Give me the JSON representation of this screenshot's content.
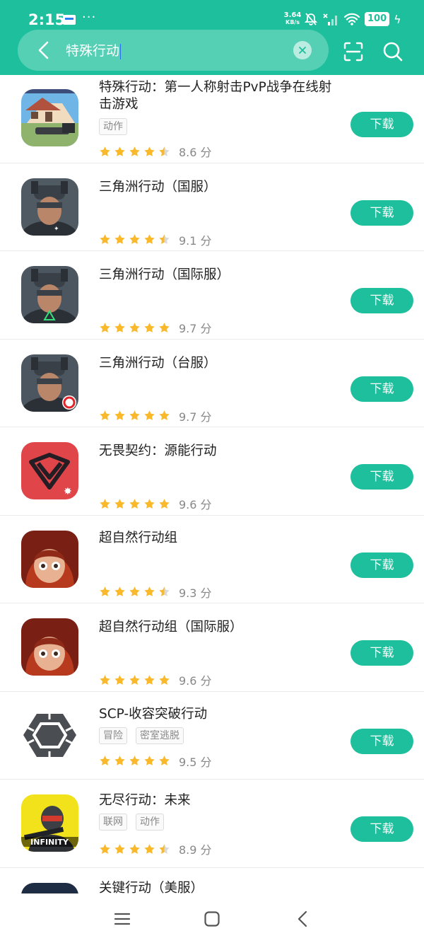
{
  "status_bar": {
    "time": "2:15",
    "dots": "···",
    "net_speed_value": "3.64",
    "net_speed_unit": "KB/s",
    "battery": "100"
  },
  "search": {
    "query": "特殊行动",
    "icons": [
      "back-arrow-icon",
      "clear-icon",
      "scan-icon",
      "search-icon"
    ]
  },
  "download_label": "下载",
  "score_unit": "分",
  "colors": {
    "accent": "#1ebf9c",
    "star": "#f9b92b",
    "star_empty": "#d9d9d9"
  },
  "apps": [
    {
      "title": "特殊行动：第一人称射击PvP战争在线射击游戏",
      "tags": [
        "动作"
      ],
      "rating": 4.5,
      "score": "8.6"
    },
    {
      "title": "三角洲行动（国服）",
      "tags": [],
      "rating": 4.5,
      "score": "9.1"
    },
    {
      "title": "三角洲行动（国际服）",
      "tags": [],
      "rating": 5,
      "score": "9.7"
    },
    {
      "title": "三角洲行动（台服）",
      "tags": [],
      "rating": 5,
      "score": "9.7"
    },
    {
      "title": "无畏契约：源能行动",
      "tags": [],
      "rating": 5,
      "score": "9.6"
    },
    {
      "title": "超自然行动组",
      "tags": [],
      "rating": 4.5,
      "score": "9.3"
    },
    {
      "title": "超自然行动组（国际服）",
      "tags": [],
      "rating": 5,
      "score": "9.6"
    },
    {
      "title": "SCP-收容突破行动",
      "tags": [
        "冒险",
        "密室逃脱"
      ],
      "rating": 5,
      "score": "9.5"
    },
    {
      "title": "无尽行动：未来",
      "tags": [
        "联网",
        "动作"
      ],
      "rating": 4.5,
      "score": "8.9"
    },
    {
      "title": "关键行动（美服）",
      "tags": [],
      "rating": null,
      "score": ""
    }
  ]
}
